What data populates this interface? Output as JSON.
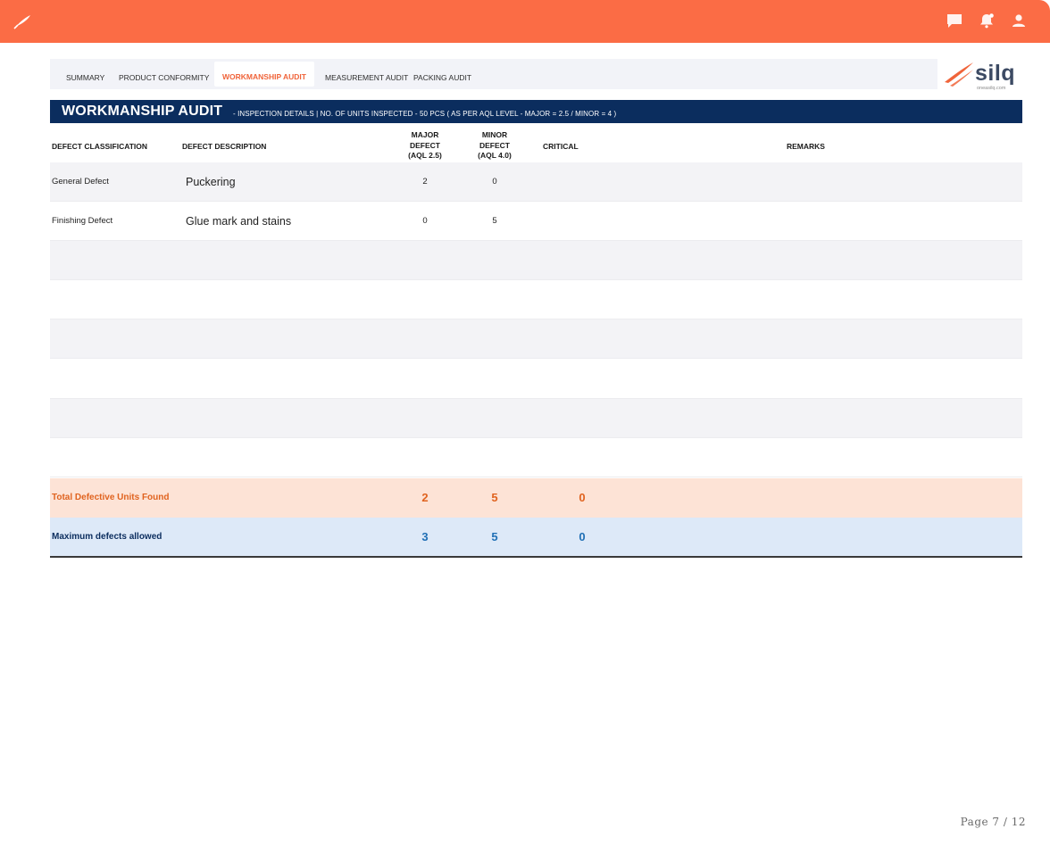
{
  "app": {
    "brand_icon": "quill-icon",
    "header_icons": [
      "chat-icon",
      "notification-bell-icon",
      "user-icon"
    ],
    "accent_color": "#fb6c45"
  },
  "tabs": [
    {
      "label": "SUMMARY",
      "active": false
    },
    {
      "label": "PRODUCT CONFORMITY",
      "active": false
    },
    {
      "label": "WORKMANSHIP AUDIT",
      "active": true
    },
    {
      "label": "MEASUREMENT AUDIT",
      "active": false
    },
    {
      "label": "PACKING AUDIT",
      "active": false
    }
  ],
  "logo": {
    "word": "silq",
    "sub": "oneasilq.com"
  },
  "banner": {
    "title": "WORKMANSHIP AUDIT",
    "subtitle": "-  INSPECTION DETAILS | NO. OF UNITS INSPECTED - 50 PCS ( AS PER AQL LEVEL -  MAJOR = 2.5 / MINOR = 4 )",
    "color": "#0b2d5e"
  },
  "table": {
    "headers": {
      "classification": "DEFECT CLASSIFICATION",
      "description": "DEFECT DESCRIPTION",
      "major": [
        "MAJOR",
        "DEFECT",
        "(AQL 2.5)"
      ],
      "minor": [
        "MINOR",
        "DEFECT",
        "(AQL 4.0)"
      ],
      "critical": "CRITICAL",
      "remarks": "REMARKS"
    },
    "rows": [
      {
        "classification": "General Defect",
        "description": "Puckering",
        "major": "2",
        "minor": "0",
        "critical": "",
        "remarks": ""
      },
      {
        "classification": "Finishing Defect",
        "description": "Glue mark and stains",
        "major": "0",
        "minor": "5",
        "critical": "",
        "remarks": ""
      },
      {
        "classification": "",
        "description": "",
        "major": "",
        "minor": "",
        "critical": "",
        "remarks": ""
      },
      {
        "classification": "",
        "description": "",
        "major": "",
        "minor": "",
        "critical": "",
        "remarks": ""
      },
      {
        "classification": "",
        "description": "",
        "major": "",
        "minor": "",
        "critical": "",
        "remarks": ""
      },
      {
        "classification": "",
        "description": "",
        "major": "",
        "minor": "",
        "critical": "",
        "remarks": ""
      },
      {
        "classification": "",
        "description": "",
        "major": "",
        "minor": "",
        "critical": "",
        "remarks": ""
      },
      {
        "classification": "",
        "description": "",
        "major": "",
        "minor": "",
        "critical": "",
        "remarks": ""
      }
    ],
    "total": {
      "label": "Total Defective Units Found",
      "major": "2",
      "minor": "5",
      "critical": "0"
    },
    "max": {
      "label": "Maximum defects allowed",
      "major": "3",
      "minor": "5",
      "critical": "0"
    }
  },
  "page": {
    "label": "Page 7 / 12"
  }
}
